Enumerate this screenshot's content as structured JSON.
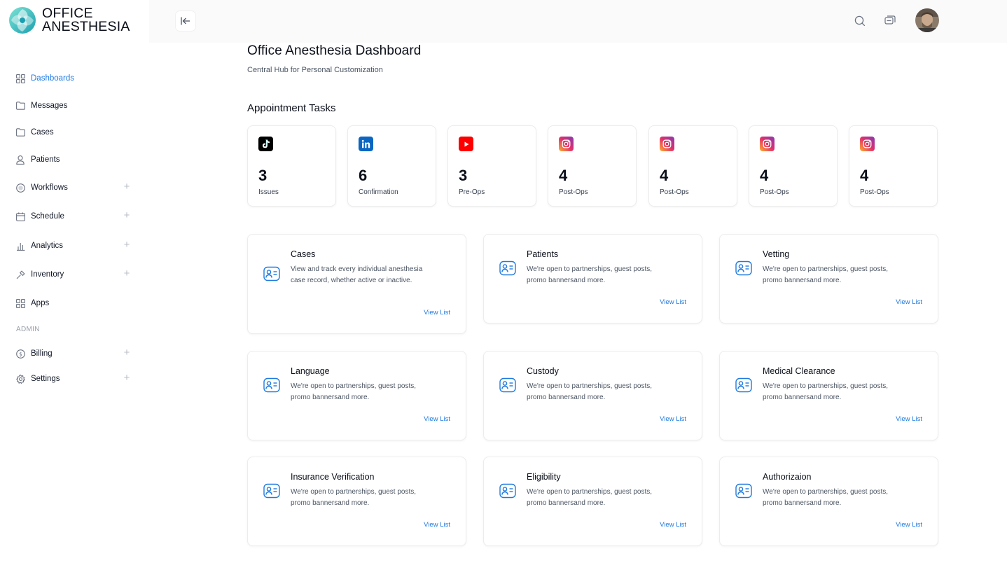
{
  "brand": {
    "line1": "OFFICE",
    "line2": "ANESTHESIA"
  },
  "sidebar": {
    "items": [
      {
        "label": "Dashboards",
        "icon": "dashboard-grid-icon",
        "active": true,
        "expandable": false
      },
      {
        "label": "Messages",
        "icon": "folder-icon",
        "active": false,
        "expandable": false
      },
      {
        "label": "Cases",
        "icon": "folder-icon",
        "active": false,
        "expandable": false
      },
      {
        "label": "Patients",
        "icon": "user-icon",
        "active": false,
        "expandable": false
      },
      {
        "label": "Workflows",
        "icon": "workflow-icon",
        "active": false,
        "expandable": true
      },
      {
        "label": "Schedule",
        "icon": "calendar-icon",
        "active": false,
        "expandable": true
      },
      {
        "label": "Analytics",
        "icon": "bar-chart-icon",
        "active": false,
        "expandable": true
      },
      {
        "label": "Inventory",
        "icon": "tool-icon",
        "active": false,
        "expandable": true
      },
      {
        "label": "Apps",
        "icon": "apps-grid-icon",
        "active": false,
        "expandable": false
      }
    ],
    "admin_label": "ADMIN",
    "admin_items": [
      {
        "label": "Billing",
        "icon": "dollar-icon",
        "expandable": true
      },
      {
        "label": "Settings",
        "icon": "gear-icon",
        "expandable": true
      }
    ]
  },
  "header": {
    "title": "Office Anesthesia Dashboard",
    "subtitle": "Central Hub for Personal Customization"
  },
  "tasks": {
    "title": "Appointment Tasks",
    "cards": [
      {
        "icon": "tiktok-icon",
        "count": "3",
        "label": "Issues"
      },
      {
        "icon": "linkedin-icon",
        "count": "6",
        "label": "Confirmation"
      },
      {
        "icon": "youtube-icon",
        "count": "3",
        "label": "Pre-Ops"
      },
      {
        "icon": "instagram-icon",
        "count": "4",
        "label": "Post-Ops"
      },
      {
        "icon": "instagram-icon",
        "count": "4",
        "label": "Post-Ops"
      },
      {
        "icon": "instagram-icon",
        "count": "4",
        "label": "Post-Ops"
      },
      {
        "icon": "instagram-icon",
        "count": "4",
        "label": "Post-Ops"
      }
    ]
  },
  "features": [
    {
      "title": "Cases",
      "desc": "View and track every individual anesthesia case record, whether active or inactive.",
      "link": "View List"
    },
    {
      "title": "Patients",
      "desc": "We're open to partnerships, guest posts, promo bannersand more.",
      "link": "View List"
    },
    {
      "title": "Vetting",
      "desc": "We're open to partnerships, guest posts, promo bannersand more.",
      "link": "View List"
    },
    {
      "title": "Language",
      "desc": "We're open to partnerships, guest posts, promo bannersand more.",
      "link": "View List"
    },
    {
      "title": "Custody",
      "desc": "We're open to partnerships, guest posts, promo bannersand more.",
      "link": "View List"
    },
    {
      "title": "Medical Clearance",
      "desc": "We're open to partnerships, guest posts, promo bannersand more.",
      "link": "View List"
    },
    {
      "title": "Insurance Verification",
      "desc": "We're open to partnerships, guest posts, promo bannersand more.",
      "link": "View List"
    },
    {
      "title": "Eligibility",
      "desc": "We're open to partnerships, guest posts, promo bannersand more.",
      "link": "View List"
    },
    {
      "title": "Authorizaion",
      "desc": "We're open to partnerships, guest posts, promo bannersand more.",
      "link": "View List"
    }
  ],
  "colors": {
    "accent": "#1f7ae0",
    "tiktok": "#000000",
    "linkedin": "#0a66c2",
    "youtube": "#ff0000",
    "instagram": "#d6249f"
  }
}
